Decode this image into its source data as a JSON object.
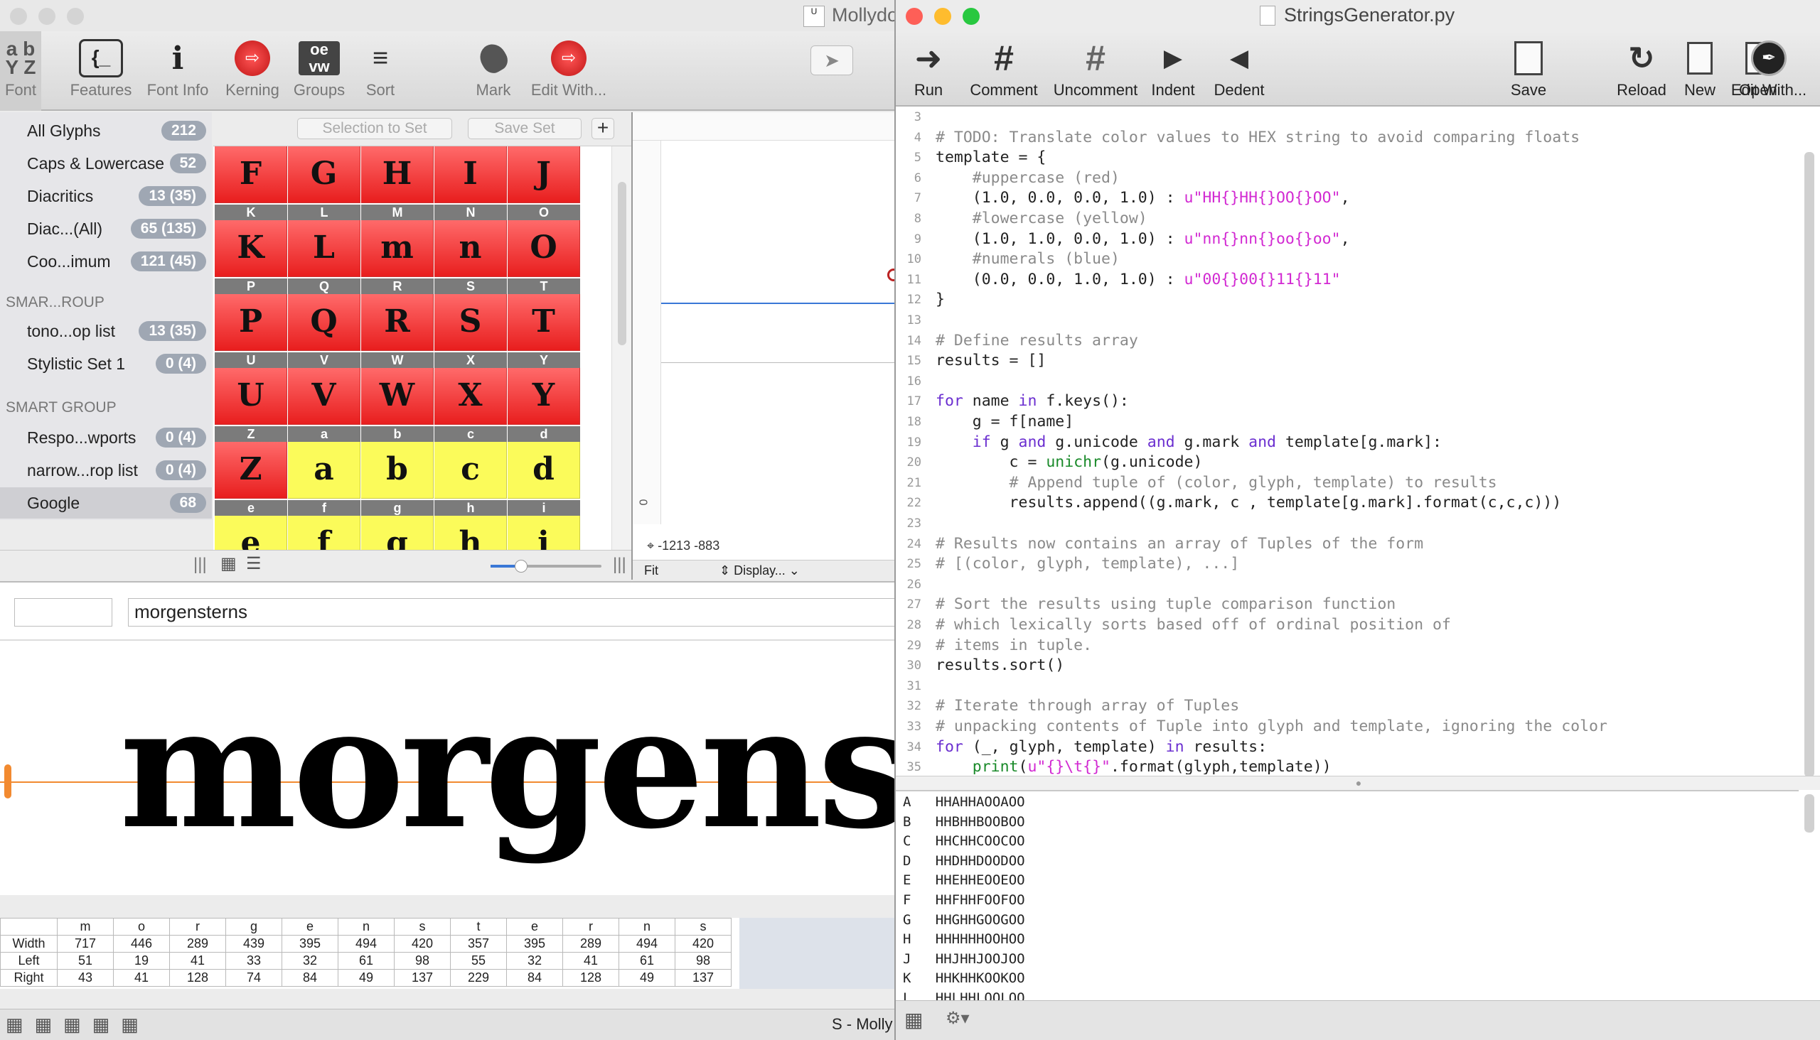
{
  "fontwin": {
    "title": "Mollydo",
    "toolbar": [
      {
        "label": "Font",
        "icon": "font-icon"
      },
      {
        "label": "Features",
        "icon": "features-icon"
      },
      {
        "label": "Font Info",
        "icon": "info-icon"
      },
      {
        "label": "Kerning",
        "icon": "kerning-icon"
      },
      {
        "label": "Groups",
        "icon": "groups-icon"
      },
      {
        "label": "Sort",
        "icon": "sort-icon"
      },
      {
        "label": "Mark",
        "icon": "mark-icon"
      },
      {
        "label": "Edit With...",
        "icon": "edit-with-icon"
      }
    ],
    "groups_glyph": "oe vw",
    "sidebar": {
      "items": [
        {
          "label": "All Glyphs",
          "count": "212"
        },
        {
          "label": "Caps & Lowercase",
          "count": "52"
        },
        {
          "label": "Diacritics",
          "count": "13 (35)"
        },
        {
          "label": "Diac...(All)",
          "count": "65 (135)"
        },
        {
          "label": "Coo...imum",
          "count": "121 (45)"
        }
      ],
      "smart_group_1": "SMAR...ROUP",
      "items2": [
        {
          "label": "tono...op list",
          "count": "13 (35)"
        },
        {
          "label": "Stylistic Set 1",
          "count": "0 (4)"
        }
      ],
      "smart_group_2": "SMART GROUP",
      "items3": [
        {
          "label": "Respo...wports",
          "count": "0 (4)"
        },
        {
          "label": "narrow...rop list",
          "count": "0 (4)"
        },
        {
          "label": "Google",
          "count": "68"
        }
      ]
    },
    "grid": {
      "selection_to_set": "Selection to Set",
      "save_set": "Save Set",
      "add": "+",
      "rows": [
        [
          "F",
          "G",
          "H",
          "I",
          "J"
        ],
        [
          "K",
          "L",
          "M",
          "N",
          "O"
        ],
        [
          "P",
          "Q",
          "R",
          "S",
          "T"
        ],
        [
          "U",
          "V",
          "W",
          "X",
          "Y"
        ],
        [
          "Z",
          "a",
          "b",
          "c",
          "d"
        ],
        [
          "e",
          "f",
          "g",
          "h",
          "i"
        ]
      ],
      "glyphs": [
        [
          "F",
          "G",
          "H",
          "I",
          "J"
        ],
        [
          "K",
          "L",
          "m",
          "n",
          "O"
        ],
        [
          "P",
          "Q",
          "R",
          "S",
          "T"
        ],
        [
          "U",
          "V",
          "W",
          "X",
          "Y"
        ],
        [
          "Z",
          "a",
          "b",
          "c",
          "d"
        ],
        [
          "e",
          "f",
          "g",
          "h",
          "i"
        ]
      ]
    },
    "editor": {
      "coords": "-1213 -883",
      "fit": "Fit",
      "display": "Display...",
      "zero": "0"
    },
    "preview": {
      "input1": "",
      "input2": "morgensterns",
      "sample": "morgenste"
    },
    "metrics": {
      "glyphs": [
        "m",
        "o",
        "r",
        "g",
        "e",
        "n",
        "s",
        "t",
        "e",
        "r",
        "n",
        "s"
      ],
      "rows": [
        {
          "label": "Width",
          "values": [
            "717",
            "446",
            "289",
            "439",
            "395",
            "494",
            "420",
            "357",
            "395",
            "289",
            "494",
            "420"
          ]
        },
        {
          "label": "Left",
          "values": [
            "51",
            "19",
            "41",
            "33",
            "32",
            "61",
            "98",
            "55",
            "32",
            "41",
            "61",
            "98"
          ]
        },
        {
          "label": "Right",
          "values": [
            "43",
            "41",
            "128",
            "74",
            "84",
            "49",
            "137",
            "229",
            "84",
            "128",
            "49",
            "137"
          ]
        }
      ]
    },
    "status": "S - Molly"
  },
  "codewin": {
    "title": "StringsGenerator.py",
    "toolbar": [
      {
        "label": "Run",
        "icon": "run-icon"
      },
      {
        "label": "Comment",
        "icon": "comment-icon"
      },
      {
        "label": "Uncomment",
        "icon": "uncomment-icon"
      },
      {
        "label": "Indent",
        "icon": "indent-icon"
      },
      {
        "label": "Dedent",
        "icon": "dedent-icon"
      },
      {
        "label": "Save",
        "icon": "save-icon"
      },
      {
        "label": "Reload",
        "icon": "reload-icon"
      },
      {
        "label": "New",
        "icon": "new-icon"
      },
      {
        "label": "Open",
        "icon": "open-icon"
      },
      {
        "label": "Edit With...",
        "icon": "edit-with-icon"
      }
    ],
    "code": [
      {
        "n": "3",
        "t": ""
      },
      {
        "n": "4",
        "t": "# TODO: Translate color values to HEX string to avoid comparing floats"
      },
      {
        "n": "5",
        "t": "template = {"
      },
      {
        "n": "6",
        "t": "    #uppercase (red)"
      },
      {
        "n": "7",
        "t": "    (1.0, 0.0, 0.0, 1.0) : u\"HH{}HH{}OO{}OO\","
      },
      {
        "n": "8",
        "t": "    #lowercase (yellow)"
      },
      {
        "n": "9",
        "t": "    (1.0, 1.0, 0.0, 1.0) : u\"nn{}nn{}oo{}oo\","
      },
      {
        "n": "10",
        "t": "    #numerals (blue)"
      },
      {
        "n": "11",
        "t": "    (0.0, 0.0, 1.0, 1.0) : u\"00{}00{}11{}11\""
      },
      {
        "n": "12",
        "t": "}"
      },
      {
        "n": "13",
        "t": ""
      },
      {
        "n": "14",
        "t": "# Define results array"
      },
      {
        "n": "15",
        "t": "results = []"
      },
      {
        "n": "16",
        "t": ""
      },
      {
        "n": "17",
        "t": "for name in f.keys():"
      },
      {
        "n": "18",
        "t": "    g = f[name]"
      },
      {
        "n": "19",
        "t": "    if g and g.unicode and g.mark and template[g.mark]:"
      },
      {
        "n": "20",
        "t": "        c = unichr(g.unicode)"
      },
      {
        "n": "21",
        "t": "        # Append tuple of (color, glyph, template) to results"
      },
      {
        "n": "22",
        "t": "        results.append((g.mark, c , template[g.mark].format(c,c,c)))"
      },
      {
        "n": "23",
        "t": ""
      },
      {
        "n": "24",
        "t": "# Results now contains an array of Tuples of the form"
      },
      {
        "n": "25",
        "t": "# [(color, glyph, template), ...]"
      },
      {
        "n": "26",
        "t": ""
      },
      {
        "n": "27",
        "t": "# Sort the results using tuple comparison function"
      },
      {
        "n": "28",
        "t": "# which lexically sorts based off of ordinal position of"
      },
      {
        "n": "29",
        "t": "# items in tuple."
      },
      {
        "n": "30",
        "t": "results.sort()"
      },
      {
        "n": "31",
        "t": ""
      },
      {
        "n": "32",
        "t": "# Iterate through array of Tuples"
      },
      {
        "n": "33",
        "t": "# unpacking contents of Tuple into glyph and template, ignoring the color"
      },
      {
        "n": "34",
        "t": "for (_, glyph, template) in results:"
      },
      {
        "n": "35",
        "t": "    print(u\"{}\\t{}\".format(glyph,template))"
      },
      {
        "n": "36",
        "t": ""
      }
    ],
    "output": [
      "A   HHAHHAOOAOO",
      "B   HHBHHBOOBOO",
      "C   HHCHHCOOCOO",
      "D   HHDHHDOODOO",
      "E   HHEHHEOOEOO",
      "F   HHFHHFOOFOO",
      "G   HHGHHGOOGOO",
      "H   HHHHHHOOHOO",
      "J   HHJHHJOOJOO",
      "K   HHKHHKOOKOO",
      "L   HHLHHLOOLOO"
    ]
  },
  "colors": {
    "red": "#e81e1e",
    "yellow": "#fbfb5a",
    "accent": "#3a78d6",
    "comment": "#8a8a8a",
    "keyword": "#6b2fd0",
    "string": "#d22ad2"
  }
}
